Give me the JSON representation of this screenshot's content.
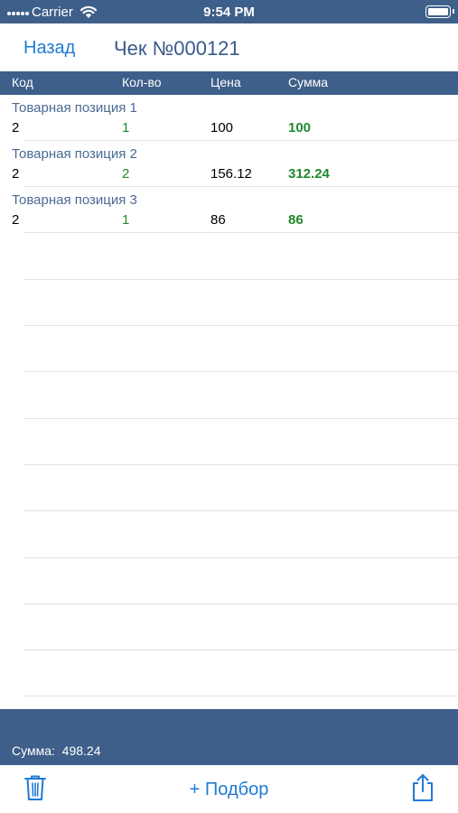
{
  "status": {
    "carrier": "Carrier",
    "time": "9:54 PM"
  },
  "nav": {
    "back_label": "Назад",
    "title": "Чек №000121"
  },
  "columns": {
    "code": "Код",
    "qty": "Кол-во",
    "price": "Цена",
    "sum": "Сумма"
  },
  "items": [
    {
      "name": "Товарная позиция 1",
      "code": "2",
      "qty": "1",
      "price": "100",
      "sum": "100"
    },
    {
      "name": "Товарная позиция 2",
      "code": "2",
      "qty": "2",
      "price": "156.12",
      "sum": "312.24"
    },
    {
      "name": "Товарная позиция 3",
      "code": "2",
      "qty": "1",
      "price": "86",
      "sum": "86"
    }
  ],
  "footer": {
    "total_label": "Сумма:",
    "total_value": "498.24"
  },
  "toolbar": {
    "pick_label": "+ Подбор"
  },
  "colors": {
    "bar": "#3e5f8a",
    "accent": "#1f7ad6",
    "green": "#1f8a2c"
  },
  "icons": {
    "delete": "trash-icon",
    "share": "share-icon"
  }
}
